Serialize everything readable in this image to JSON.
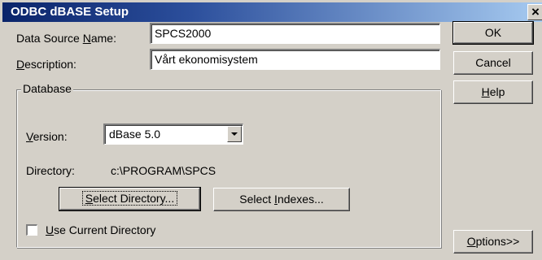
{
  "window": {
    "title": "ODBC dBASE Setup",
    "close_glyph": "×"
  },
  "fields": {
    "data_source_name": {
      "label_pre": "Data Source ",
      "label_accel": "N",
      "label_post": "ame:",
      "value": "SPCS2000"
    },
    "description": {
      "label_accel": "D",
      "label_post": "escription:",
      "value": "Vårt ekonomisystem"
    }
  },
  "buttons": {
    "ok": "OK",
    "cancel": "Cancel",
    "help_accel": "H",
    "help_post": "elp",
    "options_accel": "O",
    "options_post": "ptions>>"
  },
  "database": {
    "group_title": "Database",
    "version_label_accel": "V",
    "version_label_post": "ersion:",
    "version_value": "dBase 5.0",
    "directory_label": "Directory:",
    "directory_value": "c:\\PROGRAM\\SPCS",
    "select_directory_accel": "S",
    "select_directory_post": "elect Directory...",
    "select_indexes_pre": "Select ",
    "select_indexes_accel": "I",
    "select_indexes_post": "ndexes...",
    "use_current_accel": "U",
    "use_current_post": "se Current Directory",
    "use_current_checked": false
  }
}
